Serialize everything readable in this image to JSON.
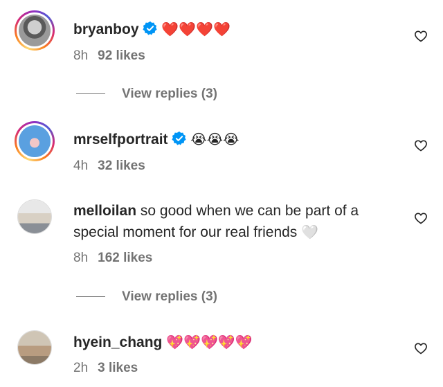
{
  "comments": [
    {
      "username": "bryanboy",
      "verified": true,
      "text": "❤️❤️❤️❤️",
      "time": "8h",
      "likes": "92 likes",
      "replies_label": "View replies (3)"
    },
    {
      "username": "mrselfportrait",
      "verified": true,
      "text": "😭😭😭",
      "time": "4h",
      "likes": "32 likes"
    },
    {
      "username": "melloilan",
      "verified": false,
      "text_line1": "so good when we can be part of a",
      "text_line2": "special moment for our real friends",
      "text_emoji": "🤍",
      "time": "8h",
      "likes": "162 likes",
      "replies_label": "View replies (3)"
    },
    {
      "username": "hyein_chang",
      "verified": false,
      "text": "💖💖💖💖💖",
      "time": "2h",
      "likes": "3 likes"
    }
  ],
  "colors": {
    "verified_blue": "#0095f6",
    "secondary_text": "#737373",
    "primary_text": "#262626"
  },
  "icons": [
    "verified-badge-icon",
    "heart-outline-icon",
    "avatar"
  ]
}
